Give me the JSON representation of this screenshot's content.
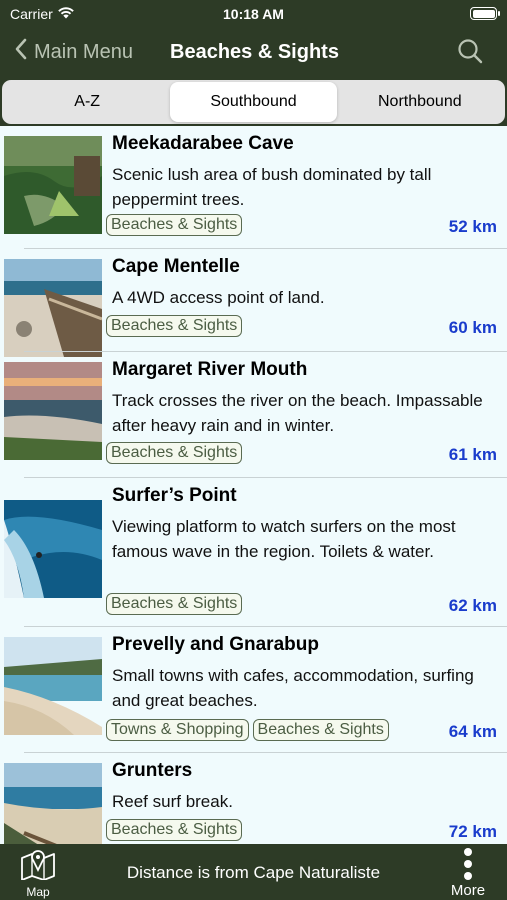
{
  "status_bar": {
    "carrier": "Carrier",
    "time": "10:18 AM"
  },
  "nav": {
    "back_label": "Main Menu",
    "title": "Beaches & Sights"
  },
  "segments": [
    "A-Z",
    "Southbound",
    "Northbound"
  ],
  "active_segment": "Southbound",
  "items": [
    {
      "title": "Meekadarabee Cave",
      "desc": "Scenic lush area of bush dominated by tall peppermint trees.",
      "tags": [
        "Beaches & Sights"
      ],
      "distance": "52 km"
    },
    {
      "title": "Cape Mentelle",
      "desc": "A 4WD access point of land.",
      "tags": [
        "Beaches & Sights"
      ],
      "distance": "60 km"
    },
    {
      "title": "Margaret River Mouth",
      "desc": "Track crosses the river on the beach. Impassable after heavy rain and in winter.",
      "tags": [
        "Beaches & Sights"
      ],
      "distance": "61 km"
    },
    {
      "title": "Surfer’s Point",
      "desc": "Viewing platform to watch surfers on the most famous wave in the region. Toilets & water.",
      "tags": [
        "Beaches & Sights"
      ],
      "distance": "62 km"
    },
    {
      "title": "Prevelly and Gnarabup",
      "desc": "Small towns with cafes, accommodation, surfing and great beaches.",
      "tags": [
        "Towns & Shopping",
        "Beaches & Sights"
      ],
      "distance": "64 km"
    },
    {
      "title": "Grunters",
      "desc": "Reef surf break.",
      "tags": [
        "Beaches & Sights"
      ],
      "distance": "72 km"
    }
  ],
  "footer": {
    "map_label": "Map",
    "info": "Distance is from Cape Naturaliste",
    "more_label": "More"
  },
  "colors": {
    "bar": "#2d3b26",
    "list_bg": "#f0fbfd",
    "distance": "#1a3ccc",
    "tag_border": "#5a6b52"
  },
  "icons": [
    "wifi-icon",
    "battery-icon",
    "chevron-left-icon",
    "search-icon",
    "map-icon",
    "more-vertical-icon"
  ]
}
